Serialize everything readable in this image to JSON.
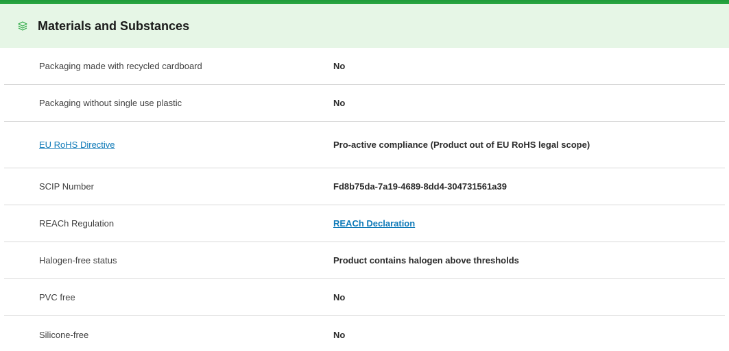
{
  "header": {
    "title": "Materials and Substances",
    "icon": "layers-icon",
    "accent_color": "#2aa842",
    "background_color": "#e6f6e6"
  },
  "rows": [
    {
      "label": "Packaging made with recycled cardboard",
      "value": "No"
    },
    {
      "label": "Packaging without single use plastic",
      "value": "No"
    },
    {
      "label": "EU RoHS Directive",
      "value": "Pro-active compliance (Product out of EU RoHS legal scope)"
    },
    {
      "label": "SCIP Number",
      "value": "Fd8b75da-7a19-4689-8dd4-304731561a39"
    },
    {
      "label": "REACh Regulation",
      "value": "REACh Declaration"
    },
    {
      "label": "Halogen-free status",
      "value": "Product contains halogen above thresholds"
    },
    {
      "label": "PVC free",
      "value": "No"
    },
    {
      "label": "Silicone-free",
      "value": "No"
    }
  ],
  "link_color": "#0f7ab8"
}
